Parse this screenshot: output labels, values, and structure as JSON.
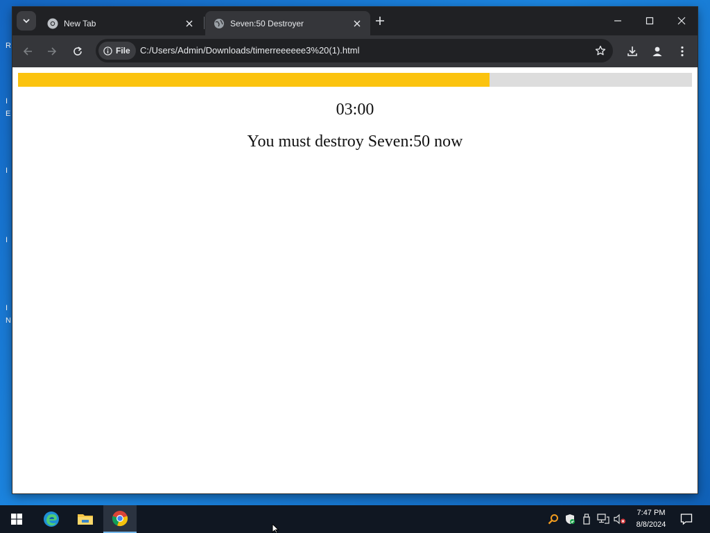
{
  "desktop": {
    "fragments": [
      "R",
      "I",
      "E",
      "I",
      "I",
      "I",
      "N"
    ]
  },
  "browser": {
    "tabs": [
      {
        "title": "New Tab",
        "favicon": "chrome-icon",
        "active": false
      },
      {
        "title": "Seven:50 Destroyer",
        "favicon": "globe-icon",
        "active": true
      }
    ],
    "site_chip_label": "File",
    "url": "C:/Users/Admin/Downloads/timerreeeeee3%20(1).html"
  },
  "page": {
    "progress": {
      "fraction": 0.7,
      "fill_color": "#fbc30f",
      "track_color": "#dddddd"
    },
    "timer": "03:00",
    "message": "You must destroy Seven:50 now"
  },
  "taskbar": {
    "apps": [
      "start-icon",
      "edge-icon",
      "file-explorer-icon",
      "chrome-icon"
    ],
    "clock_time": "7:47 PM",
    "clock_date": "8/8/2024"
  }
}
